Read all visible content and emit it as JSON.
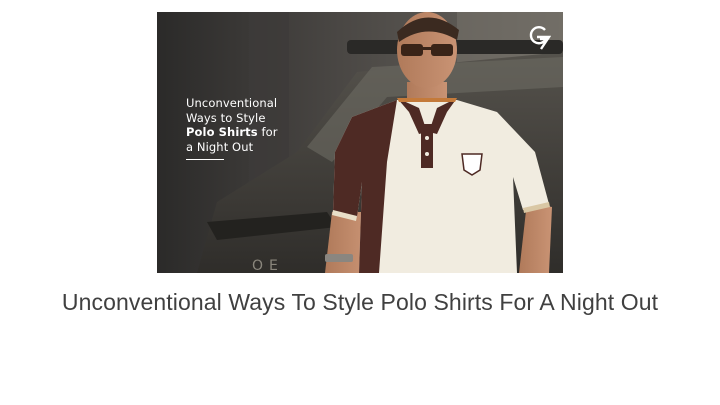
{
  "hero": {
    "headline_line1": "Unconventional",
    "headline_line2": "Ways to Style",
    "headline_line3_bold": "Polo Shirts",
    "headline_line3_rest": " for",
    "headline_line4": "a Night Out",
    "logo_icon": "g7-brand-logo"
  },
  "caption": "Unconventional Ways To Style Polo Shirts For A Night Out",
  "colors": {
    "caption_text": "#404040",
    "overlay_text": "#ffffff",
    "polo_cream": "#f1ece0",
    "polo_brown": "#4e2a24"
  }
}
